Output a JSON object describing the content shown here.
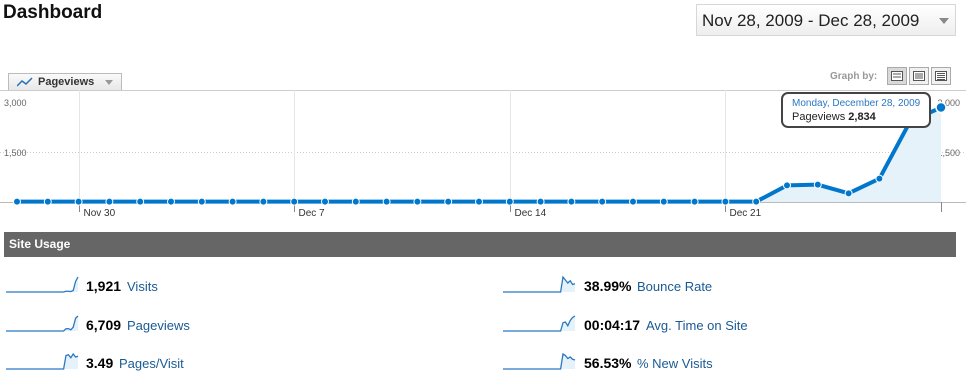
{
  "header": {
    "title": "Dashboard",
    "date_range": "Nov 28, 2009 - Dec 28, 2009"
  },
  "graph_controls": {
    "metric": "Pageviews",
    "graph_by_label": "Graph by:",
    "buttons": [
      "day-view-icon",
      "week-view-icon",
      "month-view-icon"
    ]
  },
  "chart_data": {
    "type": "line",
    "series": [
      {
        "name": "Pageviews",
        "values": [
          10,
          10,
          10,
          10,
          10,
          10,
          10,
          10,
          10,
          10,
          10,
          10,
          10,
          10,
          10,
          10,
          10,
          10,
          10,
          10,
          10,
          10,
          10,
          10,
          10,
          500,
          520,
          260,
          700,
          2420,
          2834
        ]
      }
    ],
    "x_labels": [
      "Nov 30",
      "Dec 7",
      "Dec 14",
      "Dec 21"
    ],
    "x_label_indices": [
      2,
      9,
      16,
      23
    ],
    "ylim": [
      0,
      3000
    ],
    "y_ticks_left": [
      "3,000",
      "1,500"
    ],
    "y_ticks_right": [
      "3,000",
      "1,500"
    ],
    "grid": true,
    "tooltip": {
      "date": "Monday, December 28, 2009",
      "metric": "Pageviews",
      "value": "2,834"
    },
    "colors": {
      "line": "#0077cc",
      "fill": "#e6f2fa"
    }
  },
  "site_usage": {
    "title": "Site Usage",
    "stats": [
      {
        "value": "1,921",
        "label": "Visits",
        "spark": [
          0,
          0,
          0,
          0,
          0,
          0,
          0,
          0,
          0,
          0,
          0,
          0,
          0,
          0,
          0,
          0,
          0,
          0,
          0,
          0,
          0,
          0,
          0,
          0,
          0,
          0.05,
          0.05,
          0.03,
          0.1,
          0.7,
          1
        ]
      },
      {
        "value": "6,709",
        "label": "Pageviews",
        "spark": [
          0,
          0,
          0,
          0,
          0,
          0,
          0,
          0,
          0,
          0,
          0,
          0,
          0,
          0,
          0,
          0,
          0,
          0,
          0,
          0,
          0,
          0,
          0,
          0,
          0,
          0.15,
          0.16,
          0.08,
          0.25,
          0.85,
          1
        ]
      },
      {
        "value": "3.49",
        "label": "Pages/Visit",
        "spark": [
          0,
          0,
          0,
          0,
          0,
          0,
          0,
          0,
          0,
          0,
          0,
          0,
          0,
          0,
          0,
          0,
          0,
          0,
          0,
          0,
          0,
          0,
          0,
          0,
          0,
          0.9,
          0.95,
          0.75,
          1,
          0.8,
          0.85
        ]
      },
      {
        "value": "38.99%",
        "label": "Bounce Rate",
        "spark": [
          0,
          0,
          0,
          0,
          0,
          0,
          0,
          0,
          0,
          0,
          0,
          0,
          0,
          0,
          0,
          0,
          0,
          0,
          0,
          0,
          0,
          0,
          0,
          0,
          0,
          1,
          0.8,
          0.6,
          0.75,
          0.5,
          0.55
        ]
      },
      {
        "value": "00:04:17",
        "label": "Avg. Time on Site",
        "spark": [
          0,
          0,
          0,
          0,
          0,
          0,
          0,
          0,
          0,
          0,
          0,
          0,
          0,
          0,
          0,
          0,
          0,
          0,
          0,
          0,
          0,
          0,
          0,
          0,
          0,
          0.55,
          0.6,
          0.35,
          0.7,
          0.9,
          1
        ]
      },
      {
        "value": "56.53%",
        "label": "% New Visits",
        "spark": [
          0,
          0,
          0,
          0,
          0,
          0,
          0,
          0,
          0,
          0,
          0,
          0,
          0,
          0,
          0,
          0,
          0,
          0,
          0,
          0,
          0,
          0,
          0,
          0,
          0,
          1,
          0.9,
          0.7,
          0.8,
          0.65,
          0.6
        ]
      }
    ]
  }
}
